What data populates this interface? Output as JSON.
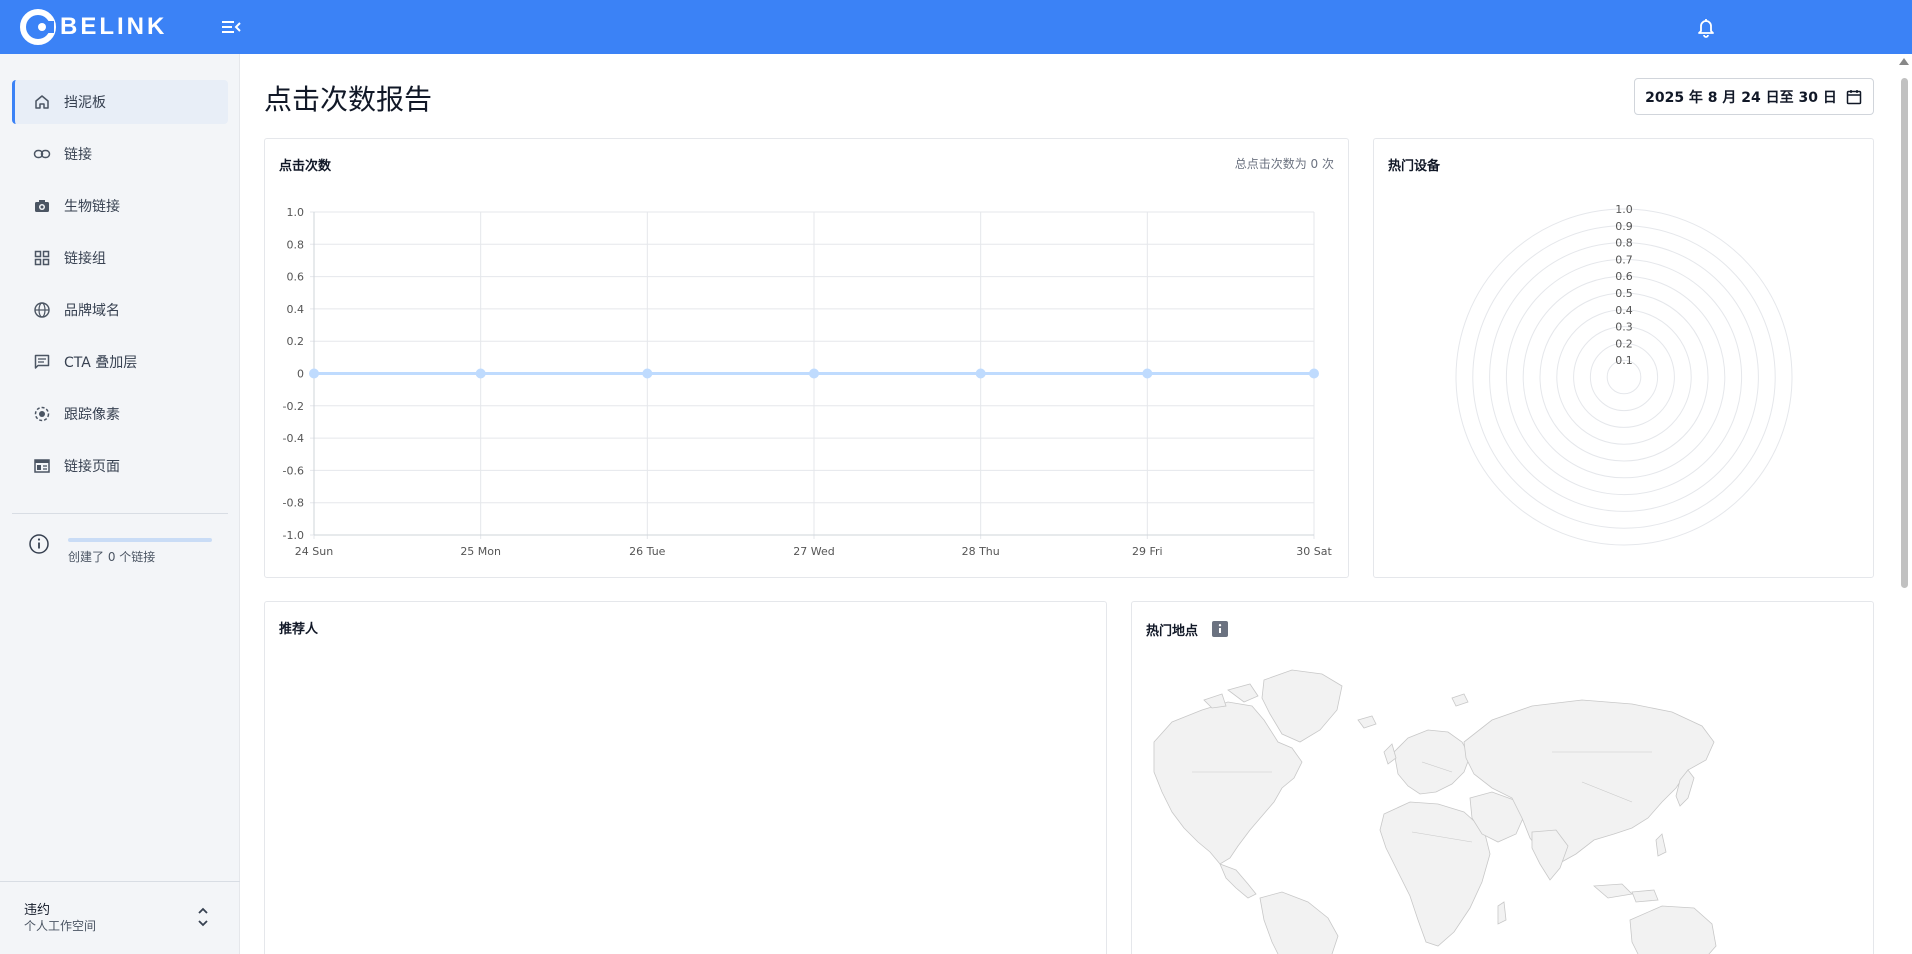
{
  "brand": {
    "name": "BELINK",
    "bar_color": "#3b82f6"
  },
  "header": {
    "menu_icon": "menu-collapse-icon",
    "notification_icon": "bell-icon"
  },
  "sidebar": {
    "items": [
      {
        "label": "挡泥板",
        "icon": "home-icon",
        "active": true
      },
      {
        "label": "链接",
        "icon": "link-icon"
      },
      {
        "label": "生物链接",
        "icon": "camera-icon"
      },
      {
        "label": "链接组",
        "icon": "grid-icon"
      },
      {
        "label": "品牌域名",
        "icon": "globe-icon"
      },
      {
        "label": "CTA 叠加层",
        "icon": "message-icon"
      },
      {
        "label": "跟踪像素",
        "icon": "pixel-target-icon"
      },
      {
        "label": "链接页面",
        "icon": "page-icon"
      }
    ],
    "usage": {
      "text": "创建了 0 个链接",
      "progress": 0,
      "icon": "info-icon"
    },
    "workspace": {
      "name": "违约",
      "type": "个人工作空间"
    }
  },
  "page": {
    "title": "点击次数报告",
    "date_range": "2025 年 8 月 24 日至 30 日"
  },
  "clicks_card": {
    "title": "点击次数",
    "total": "总点击次数为 0 次"
  },
  "devices_card": {
    "title": "热门设备"
  },
  "referrers_card": {
    "title": "推荐人"
  },
  "locations_card": {
    "title": "热门地点"
  },
  "chart_data": [
    {
      "type": "line",
      "x": [
        "24 Sun",
        "25 Mon",
        "26 Tue",
        "27 Wed",
        "28 Thu",
        "29 Fri",
        "30 Sat"
      ],
      "series": [
        {
          "values": [
            0,
            0,
            0,
            0,
            0,
            0,
            0
          ]
        }
      ],
      "y_ticks": [
        "1.0",
        "0.8",
        "0.6",
        "0.4",
        "0.2",
        "0",
        "-0.2",
        "-0.4",
        "-0.6",
        "-0.8",
        "-1.0"
      ],
      "ylim": [
        -1,
        1
      ],
      "grid": true,
      "line_color": "#bfdbfe"
    },
    {
      "type": "radar",
      "r_ticks": [
        "1.0",
        "0.9",
        "0.8",
        "0.7",
        "0.6",
        "0.5",
        "0.4",
        "0.3",
        "0.2",
        "0.1"
      ],
      "rlim": [
        0,
        1
      ]
    }
  ]
}
